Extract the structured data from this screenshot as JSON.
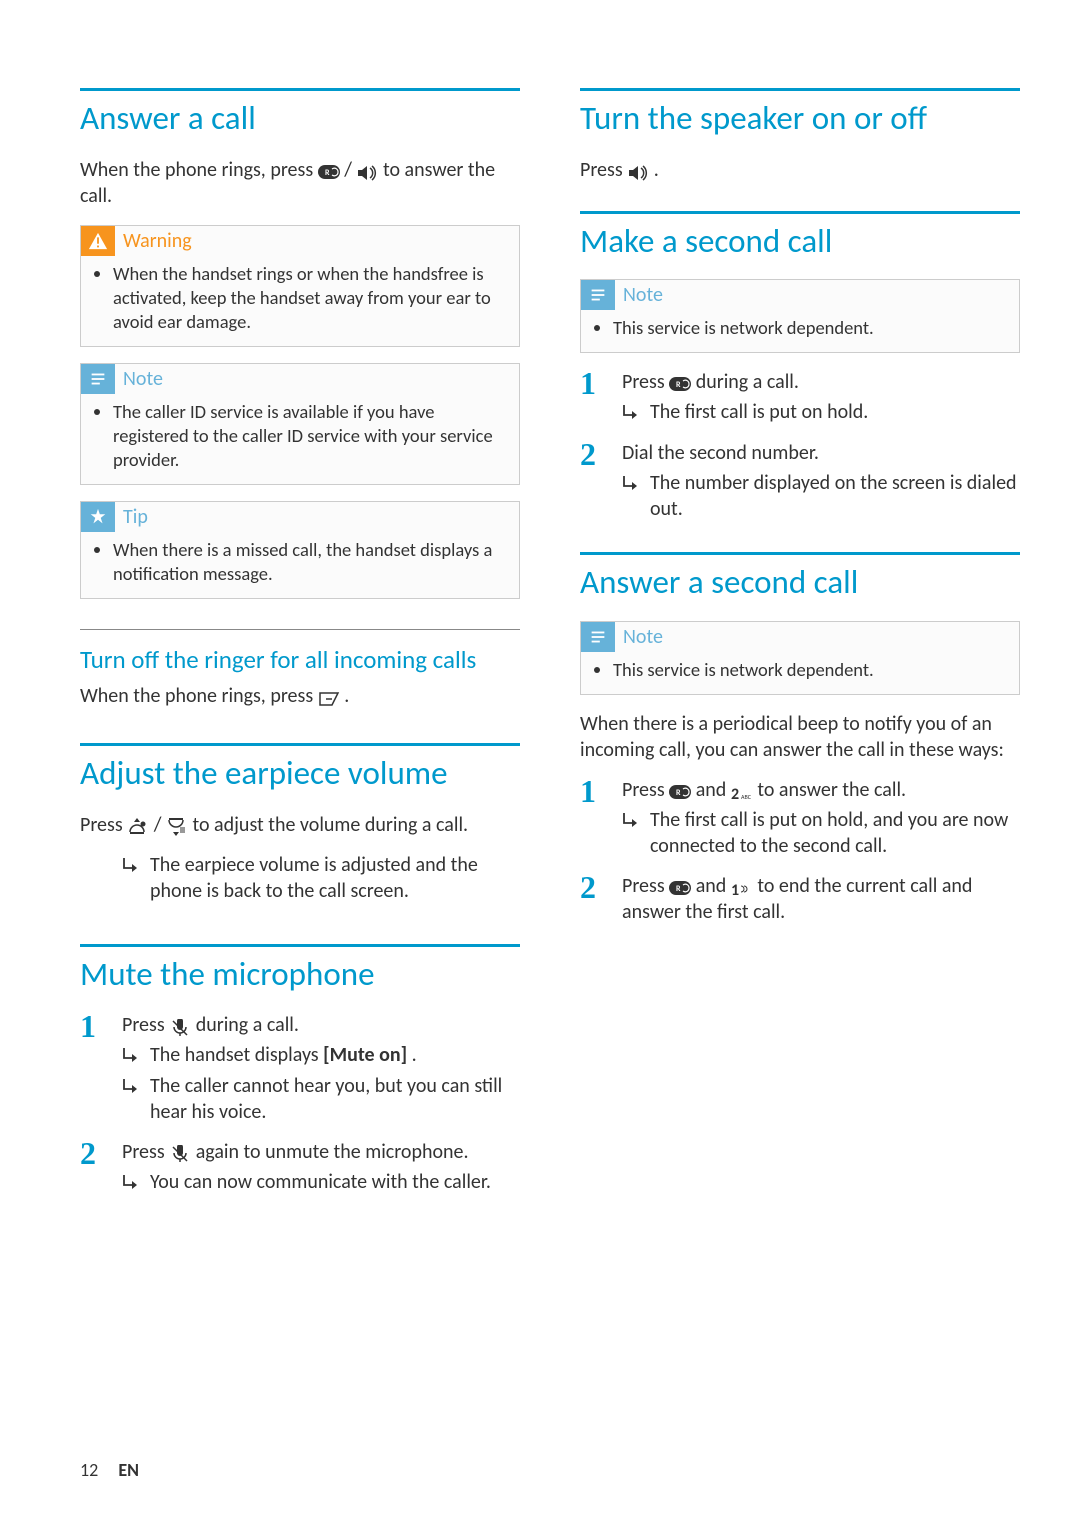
{
  "footer": {
    "page_num": "12",
    "lang": "EN"
  },
  "icons": {
    "talk_key": "R-handset-icon",
    "speaker": "speaker-icon",
    "end_key": "end-key-icon",
    "vol_up": "vol-up-icon",
    "vol_down": "vol-down-icon",
    "mute": "mute-icon",
    "key2": "2abc-key",
    "key1": "1-key"
  },
  "left": {
    "answer_call": {
      "title": "Answer a call",
      "intro_1": "When the phone rings, press ",
      "intro_2": " / ",
      "intro_3": " to answer the call.",
      "warning_label": "Warning",
      "warning_text": "When the handset rings or when the handsfree is activated, keep the handset away from your ear to avoid ear damage.",
      "note_label": "Note",
      "note_text": "The caller ID service is available if you have registered to the caller ID service with your service provider.",
      "tip_label": "Tip",
      "tip_text": "When there is a missed call, the handset displays a notification message."
    },
    "ringer_off": {
      "title": "Turn off the ringer for all incoming calls",
      "text_1": "When the phone rings, press ",
      "text_2": "."
    },
    "adjust_vol": {
      "title": "Adjust the earpiece volume",
      "text_1": "Press ",
      "text_2": " / ",
      "text_3": " to adjust the volume during a call.",
      "result": "The earpiece volume is adjusted and the phone is back to the call screen."
    },
    "mute_mic": {
      "title": "Mute the microphone",
      "step1_1": "Press ",
      "step1_2": " during a call.",
      "step1_res1_1": "The handset displays ",
      "step1_res1_bold": "[Mute on]",
      "step1_res1_2": ".",
      "step1_res2": "The caller cannot hear you, but you can still hear his voice.",
      "step2_1": "Press ",
      "step2_2": " again to unmute the microphone.",
      "step2_res": "You can now communicate with the caller."
    }
  },
  "right": {
    "speaker": {
      "title": "Turn the speaker on or off",
      "text_1": "Press ",
      "text_2": "."
    },
    "second_call_make": {
      "title": "Make a second call",
      "note_label": "Note",
      "note_text": "This service is network dependent.",
      "step1_1": "Press ",
      "step1_2": " during a call.",
      "step1_res": "The first call is put on hold.",
      "step2": "Dial the second number.",
      "step2_res": "The number displayed on the screen is dialed out."
    },
    "second_call_answer": {
      "title": "Answer a second call",
      "note_label": "Note",
      "note_text": "This service is network dependent.",
      "intro": "When there is a periodical beep to notify you of an incoming call, you can answer the call in these ways:",
      "step1_1": "Press ",
      "step1_2": " and ",
      "step1_3": " to answer the call.",
      "step1_res": "The first call is put on hold, and you are now connected to the second call.",
      "step2_1": "Press ",
      "step2_2": " and ",
      "step2_3": " to end the current call and answer the first call."
    }
  }
}
